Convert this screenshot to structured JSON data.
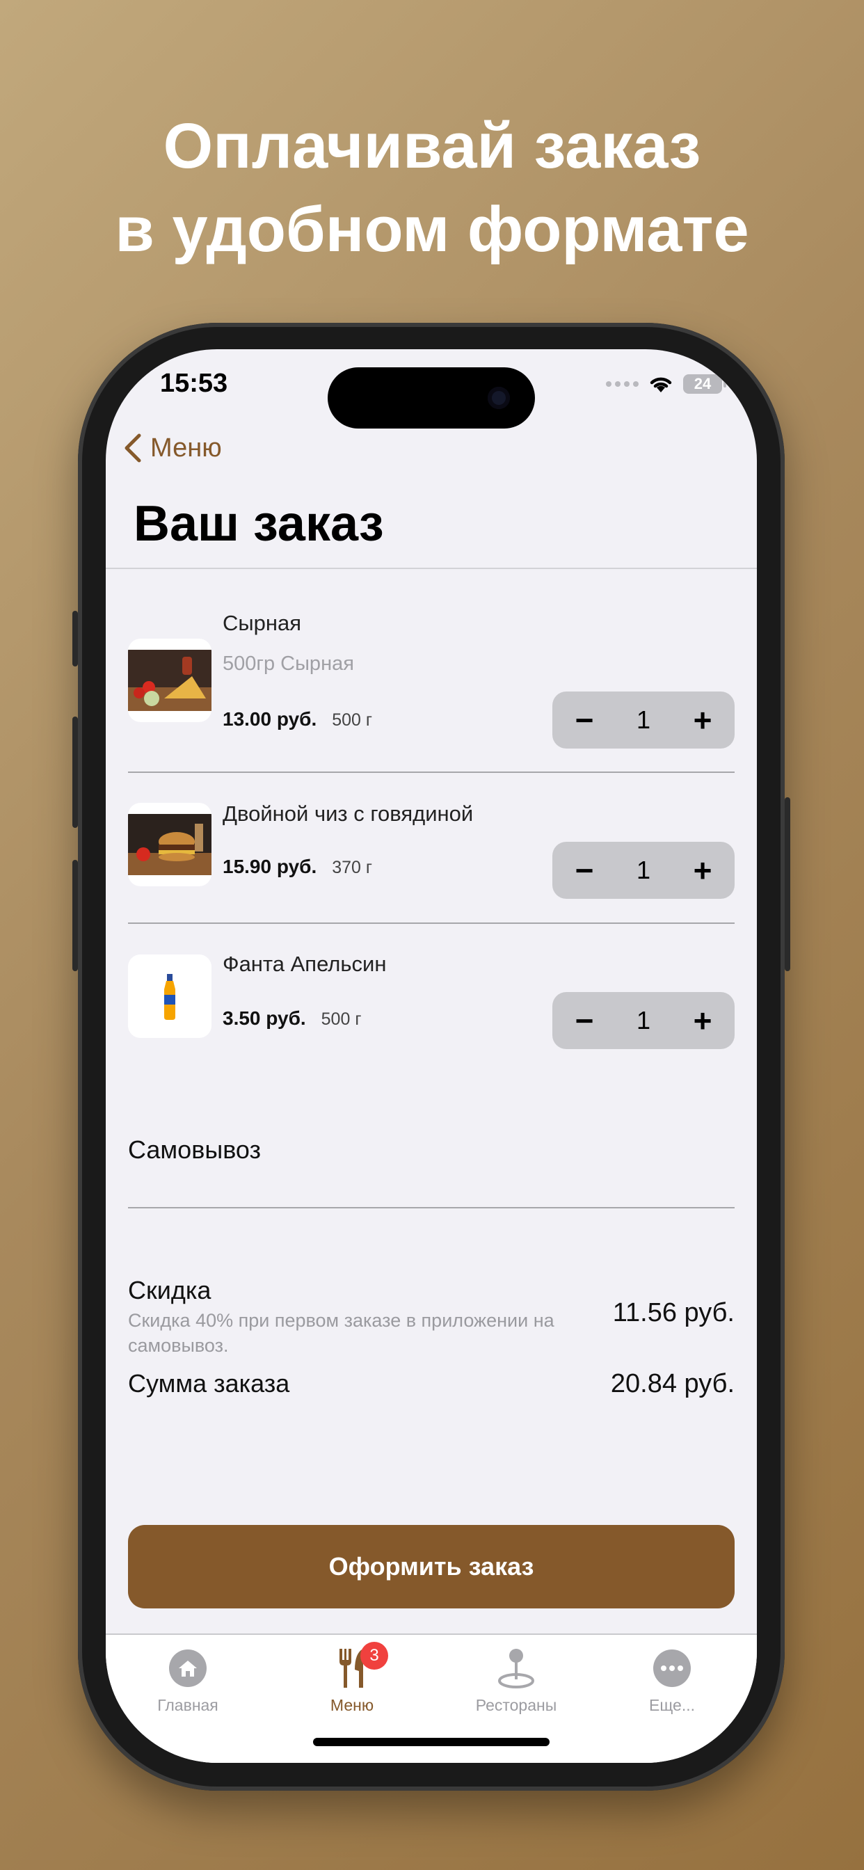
{
  "promo": {
    "line1": "Оплачивай заказ",
    "line2": "в удобном формате"
  },
  "status_bar": {
    "time": "15:53",
    "battery": "24"
  },
  "nav": {
    "back_label": "Меню",
    "title": "Ваш заказ"
  },
  "items": [
    {
      "name": "Сырная",
      "description": "500гр Сырная",
      "price": "13.00 руб.",
      "weight": "500 г",
      "quantity": "1",
      "image": "cheese-pizza-image"
    },
    {
      "name": "Двойной чиз с говядиной",
      "price": "15.90 руб.",
      "weight": "370 г",
      "quantity": "1",
      "image": "burger-image"
    },
    {
      "name": "Фанта Апельсин",
      "price": "3.50 руб.",
      "weight": "500 г",
      "quantity": "1",
      "image": "fanta-bottle-image"
    }
  ],
  "stepper": {
    "minus": "−",
    "plus": "+"
  },
  "delivery": {
    "method": "Самовывоз"
  },
  "summary": {
    "discount_label": "Скидка",
    "discount_note": "Скидка 40% при первом заказе в приложении на самовывоз.",
    "discount_value": "11.56 руб.",
    "total_label": "Сумма заказа",
    "total_value": "20.84 руб."
  },
  "checkout": {
    "label": "Оформить заказ"
  },
  "tabbar": {
    "tabs": [
      {
        "label": "Главная",
        "icon": "home-icon"
      },
      {
        "label": "Меню",
        "icon": "fork-knife-icon",
        "badge": "3",
        "active": true
      },
      {
        "label": "Рестораны",
        "icon": "map-pin-icon"
      },
      {
        "label": "Еще...",
        "icon": "more-icon"
      }
    ]
  },
  "colors": {
    "accent": "#85592b",
    "badge": "#f0413e",
    "screen_bg": "#f2f1f6"
  }
}
